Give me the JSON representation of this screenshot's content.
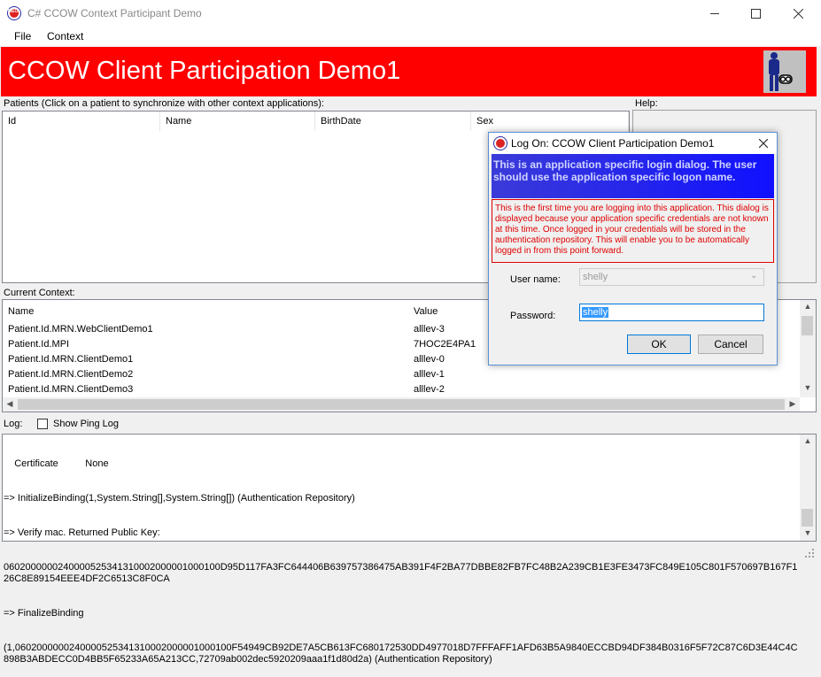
{
  "window": {
    "title": "C# CCOW Context Participant Demo",
    "app_icon_text": "MEO"
  },
  "menu": {
    "file": "File",
    "context": "Context"
  },
  "banner": {
    "title": "CCOW Client Participation Demo1",
    "color": "#ff0000"
  },
  "patients": {
    "label": "Patients (Click on a patient to synchronize with other context applications):",
    "columns": [
      "Id",
      "Name",
      "BirthDate",
      "Sex"
    ]
  },
  "help": {
    "label": "Help:"
  },
  "context": {
    "label": "Current Context:",
    "columns": [
      "Name",
      "Value"
    ],
    "rows": [
      {
        "name": "Patient.Id.MRN.WebClientDemo1",
        "value": "alllev-3"
      },
      {
        "name": "Patient.Id.MPI",
        "value": "7HOC2E4PA1"
      },
      {
        "name": "Patient.Id.MRN.ClientDemo1",
        "value": "alllev-0"
      },
      {
        "name": "Patient.Id.MRN.ClientDemo2",
        "value": "alllev-1"
      },
      {
        "name": "Patient.Id.MRN.ClientDemo3",
        "value": "alllev-2"
      }
    ]
  },
  "log": {
    "label": "Log:",
    "show_ping_label": "Show Ping Log",
    "show_ping_checked": false,
    "lines": [
      "    Certificate          None",
      "=> InitializeBinding(1,System.String[],System.String[]) (Authentication Repository)",
      "=> Verify mac. Returned Public Key:",
      "0602000000240000525341310002000001000100D95D117FA3FC644406B639757386475AB391F4F2BA77DBBE82FB7FC48B2A239CB1E3FE3473FC849E105C801F570697B167F126C8E89154EEE4DF2C6513C8F0CA",
      "=> FinalizeBinding",
      "(1,0602000000240000525341310002000001000100F54949CB92DE7A5CB613FC680172530DD4977018D7FFFAFF1AFD63B5A9840ECCBD94DF384B0316F5F72C87C6D3E44C4C898B3ABDECC0D4BB5F65233A65A213CC,72709ab002dec5920209aaa1f1d80d2a) (Authentication Repository)"
    ]
  },
  "dialog": {
    "title": "Log On: CCOW Client Participation Demo1",
    "header": "This is an application specific login dialog.  The user should use the application specific logon name.",
    "message": "This is the first time you are logging into this application.  This dialog is displayed because your application specific credentials are not known at this time.  Once logged in your credentials will be stored in the authentication repository.  This will enable you to be automatically logged in from this point forward.",
    "username_label": "User name:",
    "username_value": "shelly",
    "password_label": "Password:",
    "password_value": "shelly",
    "ok_label": "OK",
    "cancel_label": "Cancel",
    "message_color": "#e00000"
  }
}
